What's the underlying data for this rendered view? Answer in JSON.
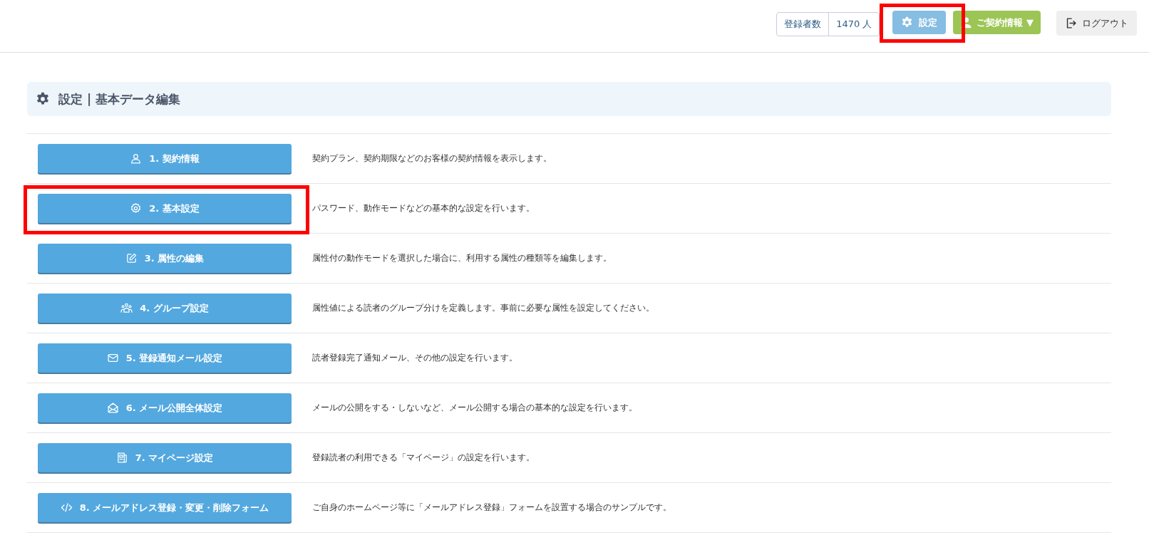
{
  "header": {
    "subscriber_count": {
      "label": "登録者数",
      "value": "1470 人"
    },
    "settings_button": {
      "label": "設定",
      "highlighted": true
    },
    "contract_button": {
      "label": "ご契約情報 ▼"
    },
    "logout_button": {
      "label": "ログアウト"
    }
  },
  "panel": {
    "title": "設定 | 基本データ編集"
  },
  "items": [
    {
      "label": "1. 契約情報",
      "description": "契約プラン、契約期限などのお客様の契約情報を表示します。",
      "highlighted": false
    },
    {
      "label": "2. 基本設定",
      "description": "パスワード、動作モードなどの基本的な設定を行います。",
      "highlighted": true
    },
    {
      "label": "3. 属性の編集",
      "description": "属性付の動作モードを選択した場合に、利用する属性の種類等を編集します。",
      "highlighted": false
    },
    {
      "label": "4. グループ設定",
      "description": "属性値による読者のグループ分けを定義します。事前に必要な属性を設定してください。",
      "highlighted": false
    },
    {
      "label": "5. 登録通知メール設定",
      "description": "読者登録完了通知メール、その他の設定を行います。",
      "highlighted": false
    },
    {
      "label": "6. メール公開全体設定",
      "description": "メールの公開をする・しないなど、メール公開する場合の基本的な設定を行います。",
      "highlighted": false
    },
    {
      "label": "7. マイページ設定",
      "description": "登録読者の利用できる「マイページ」の設定を行います。",
      "highlighted": false
    },
    {
      "label": "8. メールアドレス登録・変更・削除フォーム",
      "description": "ご自身のホームページ等に「メールアドレス登録」フォームを設置する場合のサンプルです。",
      "highlighted": false
    }
  ]
}
